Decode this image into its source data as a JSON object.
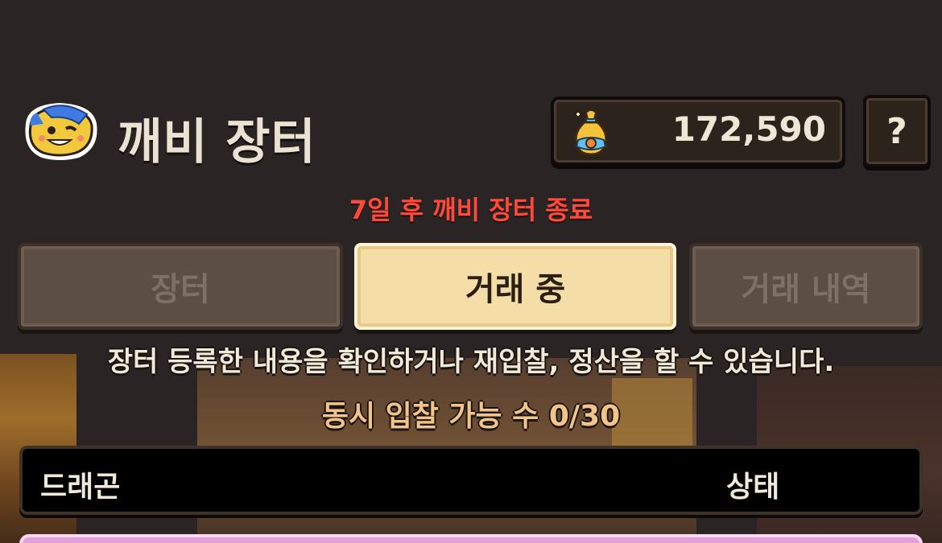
{
  "header": {
    "title": "깨비 장터",
    "currency_value": "172,590",
    "help_label": "?"
  },
  "notice": "7일 후 깨비 장터 종료",
  "tabs": [
    {
      "label": "장터",
      "active": false
    },
    {
      "label": "거래 중",
      "active": true
    },
    {
      "label": "거래 내역",
      "active": false
    }
  ],
  "description": "장터 등록한 내용을 확인하거나 재입찰, 정산을 할 수 있습니다.",
  "bid_count": "동시 입찰 가능 수 0/30",
  "table": {
    "columns": [
      "드래곤",
      "상태"
    ]
  },
  "colors": {
    "background": "#2a2425",
    "notice": "#ff4a3a",
    "active_tab": "#f5dda8",
    "inactive_tab": "#5c4e45",
    "bid_count": "#f3c489",
    "list_row": "#e4a1d8"
  },
  "icons": {
    "mascot": "goblin-mascot-icon",
    "currency": "money-bag-icon"
  }
}
